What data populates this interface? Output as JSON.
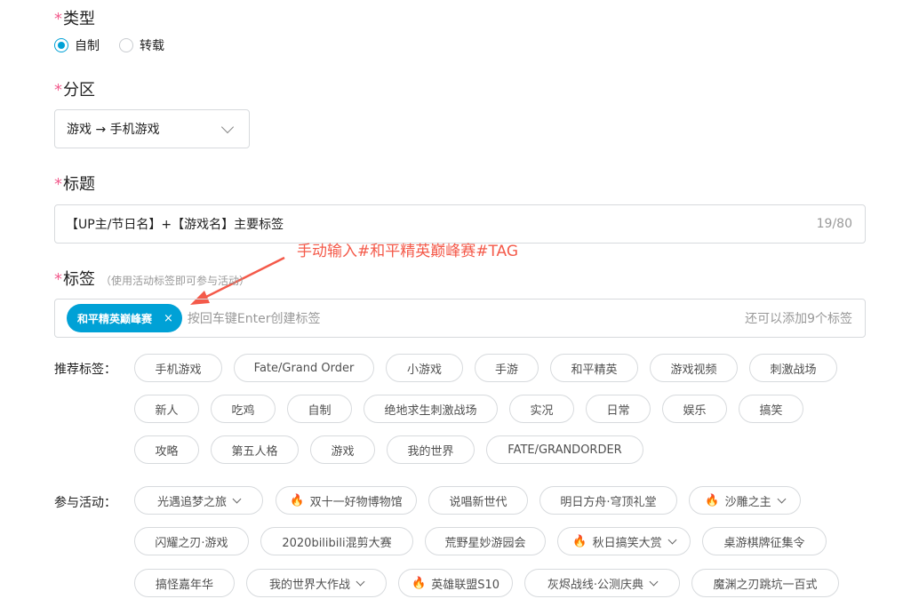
{
  "type_section": {
    "label": "类型",
    "options": [
      {
        "label": "自制",
        "selected": true
      },
      {
        "label": "转载",
        "selected": false
      }
    ]
  },
  "partition_section": {
    "label": "分区",
    "value": "游戏 → 手机游戏",
    "icon": "chevron-down-icon"
  },
  "title_section": {
    "label": "标题",
    "value": "【UP主/节日名】+【游戏名】主要标签",
    "counter": "19/80"
  },
  "tags_section": {
    "label": "标签",
    "hint": "（使用活动标签即可参与活动）",
    "chip": "和平精英巅峰赛",
    "chip_close": "×",
    "placeholder": "按回车键Enter创建标签",
    "remaining": "还可以添加9个标签"
  },
  "annotation": {
    "text": "手动输入#和平精英巅峰赛#TAG",
    "color": "#f45a4a"
  },
  "recommended": {
    "label": "推荐标签：",
    "tags": [
      "手机游戏",
      "Fate/Grand Order",
      "小游戏",
      "手游",
      "和平精英",
      "游戏视频",
      "刺激战场",
      "新人",
      "吃鸡",
      "自制",
      "绝地求生刺激战场",
      "实况",
      "日常",
      "娱乐",
      "搞笑",
      "攻略",
      "第五人格",
      "游戏",
      "我的世界",
      "FATE/GRANDORDER"
    ]
  },
  "activities": {
    "label": "参与活动：",
    "items": [
      {
        "label": "光遇追梦之旅",
        "hot": false,
        "dropdown": true
      },
      {
        "label": "双十一好物博物馆",
        "hot": true,
        "dropdown": false
      },
      {
        "label": "说唱新世代",
        "hot": false,
        "dropdown": false
      },
      {
        "label": "明日方舟·穹顶礼堂",
        "hot": false,
        "dropdown": false
      },
      {
        "label": "沙雕之主",
        "hot": true,
        "dropdown": true
      },
      {
        "label": "闪耀之刃·游戏",
        "hot": false,
        "dropdown": false
      },
      {
        "label": "2020bilibili混剪大赛",
        "hot": false,
        "dropdown": false
      },
      {
        "label": "荒野星妙游园会",
        "hot": false,
        "dropdown": false
      },
      {
        "label": "秋日搞笑大赏",
        "hot": true,
        "dropdown": true
      },
      {
        "label": "桌游棋牌征集令",
        "hot": false,
        "dropdown": false
      },
      {
        "label": "搞怪嘉年华",
        "hot": false,
        "dropdown": false
      },
      {
        "label": "我的世界大作战",
        "hot": false,
        "dropdown": true
      },
      {
        "label": "英雄联盟S10",
        "hot": true,
        "dropdown": false
      },
      {
        "label": "灰烬战线·公测庆典",
        "hot": false,
        "dropdown": true
      },
      {
        "label": "魔渊之刃跳坑一百式",
        "hot": false,
        "dropdown": false
      }
    ]
  },
  "colors": {
    "accent": "#00a1d6",
    "required_star": "#f25d8e",
    "annotation": "#f45a4a"
  }
}
